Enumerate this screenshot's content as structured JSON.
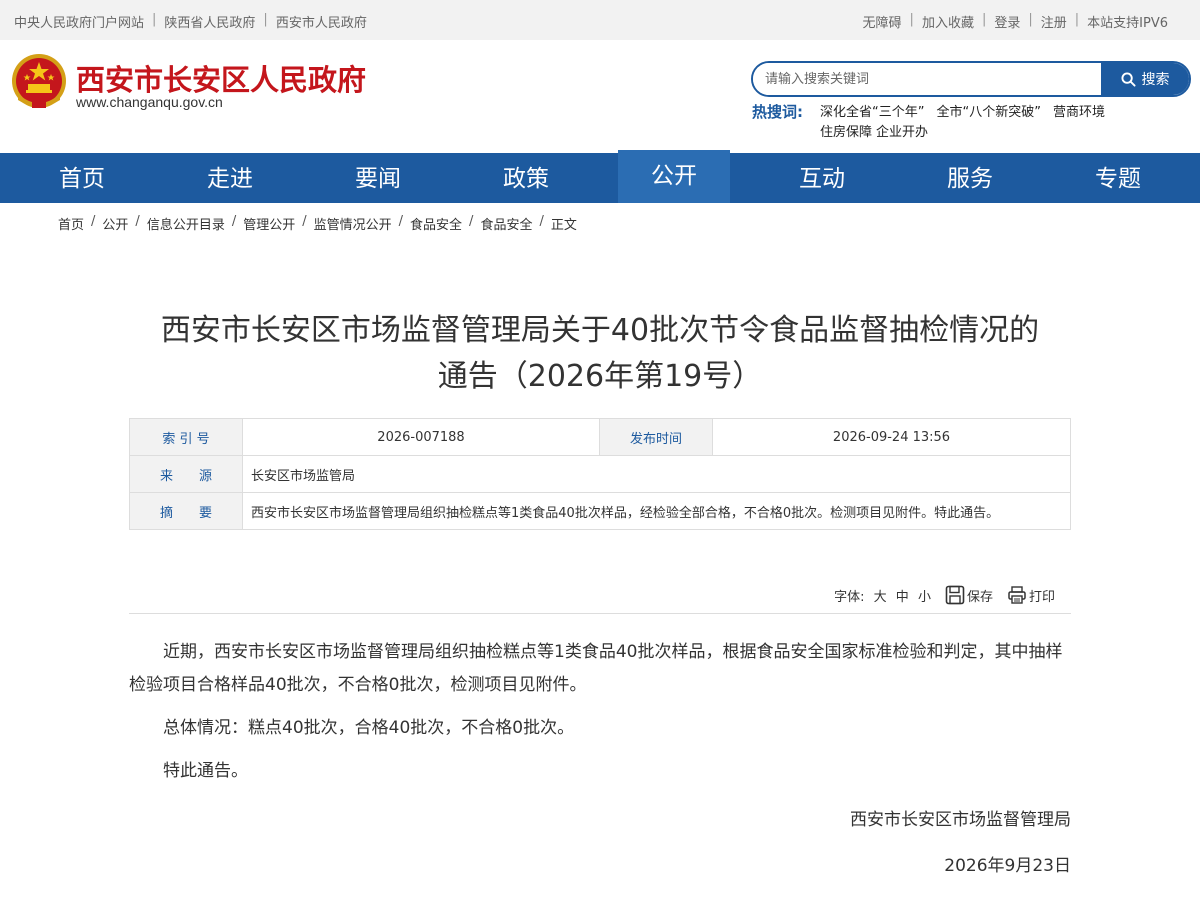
{
  "topbar": {
    "left_links": [
      "中央人民政府门户网站",
      "陕西省人民政府",
      "西安市人民政府"
    ],
    "right_links": [
      "无障碍",
      "加入收藏",
      "登录",
      "注册",
      "本站支持IPV6"
    ]
  },
  "header": {
    "site_title": "西安市长安区人民政府",
    "site_url": "www.changanqu.gov.cn",
    "search_placeholder": "请输入搜索关键词",
    "search_button": "搜索",
    "hot_label": "热搜词:",
    "hot_words": [
      "深化全省“三个年”",
      "全市“八个新突破”",
      "营商环境",
      "住房保障",
      "企业开办"
    ]
  },
  "nav": {
    "items": [
      "首页",
      "走进",
      "要闻",
      "政策",
      "公开",
      "互动",
      "服务",
      "专题"
    ],
    "active": "公开"
  },
  "breadcrumb": [
    "首页",
    "公开",
    "信息公开目录",
    "管理公开",
    "监管情况公开",
    "食品安全",
    "食品安全",
    "正文"
  ],
  "article": {
    "title_line1": "西安市长安区市场监督管理局关于40批次节令食品监督抽检情况的",
    "title_line2": "通告（2026年第19号）",
    "meta": {
      "index_label": "索 引 号",
      "index_value": "2026-007188",
      "date_label": "发布时间",
      "date_value": "2026-09-24 13:56",
      "source_label": "来　　源",
      "source_value": "长安区市场监管局",
      "summary_label": "摘　　要",
      "summary_value": "西安市长安区市场监督管理局组织抽检糕点等1类食品40批次样品，经检验全部合格，不合格0批次。检测项目见附件。特此通告。"
    },
    "tools": {
      "font_label": "字体:",
      "font_large": "大",
      "font_medium": "中",
      "font_small": "小",
      "save": "保存",
      "print": "打印"
    },
    "paragraphs": [
      "近期，西安市长安区市场监督管理局组织抽检糕点等1类食品40批次样品，根据食品安全国家标准检验和判定，其中抽样检验项目合格样品40批次，不合格0批次，检测项目见附件。",
      "总体情况：糕点40批次，合格40批次，不合格0批次。",
      "特此通告。"
    ],
    "signature": "西安市长安区市场监督管理局",
    "date": "2026年9月23日"
  },
  "colors": {
    "primary_blue": "#1d5a9f",
    "title_red": "#c4161c",
    "topbar_bg": "#f2f2f2"
  }
}
